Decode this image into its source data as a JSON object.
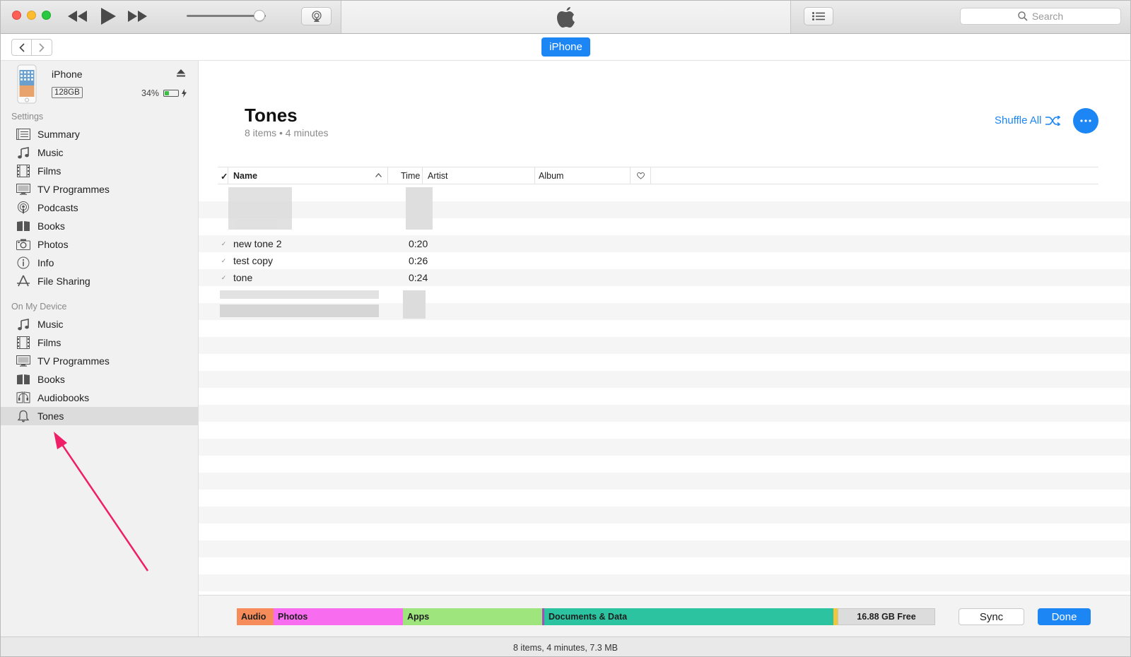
{
  "colors": {
    "accent": "#1b86f4",
    "audio": "#f58c59",
    "photos": "#f86df0",
    "apps": "#9fe57e",
    "docs": "#2bc3a0",
    "free": "#dcdcdc",
    "battery": "#36c23f",
    "arrow": "#ee1f66"
  },
  "toolbar": {
    "search_placeholder": "Search"
  },
  "navbar": {
    "device_tab": "iPhone"
  },
  "device": {
    "name": "iPhone",
    "capacity": "128GB",
    "battery": "34%",
    "battery_level": 0.34
  },
  "sidebar": {
    "settings_header": "Settings",
    "settings": [
      {
        "label": "Summary",
        "icon": "summary-icon"
      },
      {
        "label": "Music",
        "icon": "music-note-icon"
      },
      {
        "label": "Films",
        "icon": "film-icon"
      },
      {
        "label": "TV Programmes",
        "icon": "tv-icon"
      },
      {
        "label": "Podcasts",
        "icon": "podcast-icon"
      },
      {
        "label": "Books",
        "icon": "book-icon"
      },
      {
        "label": "Photos",
        "icon": "camera-icon"
      },
      {
        "label": "Info",
        "icon": "info-icon"
      },
      {
        "label": "File Sharing",
        "icon": "app-store-icon"
      }
    ],
    "device_header": "On My Device",
    "device_items": [
      {
        "label": "Music",
        "icon": "music-note-icon"
      },
      {
        "label": "Films",
        "icon": "film-icon"
      },
      {
        "label": "TV Programmes",
        "icon": "tv-icon"
      },
      {
        "label": "Books",
        "icon": "book-icon"
      },
      {
        "label": "Audiobooks",
        "icon": "audiobook-icon"
      },
      {
        "label": "Tones",
        "icon": "bell-icon",
        "selected": true
      }
    ]
  },
  "main": {
    "title": "Tones",
    "subtitle": "8 items • 4 minutes",
    "shuffle_label": "Shuffle All",
    "columns": {
      "check": "✓",
      "name": "Name",
      "time": "Time",
      "artist": "Artist",
      "album": "Album"
    },
    "rows": [
      {
        "name": "new tone 2",
        "time": "0:20"
      },
      {
        "name": "test copy",
        "time": "0:26"
      },
      {
        "name": "tone",
        "time": "0:24"
      }
    ]
  },
  "storage": {
    "audio": "Audio",
    "photos": "Photos",
    "apps": "Apps",
    "docs": "Documents & Data",
    "free": "16.88 GB Free",
    "sync": "Sync",
    "done": "Done"
  },
  "status": "8 items, 4 minutes, 7.3 MB"
}
